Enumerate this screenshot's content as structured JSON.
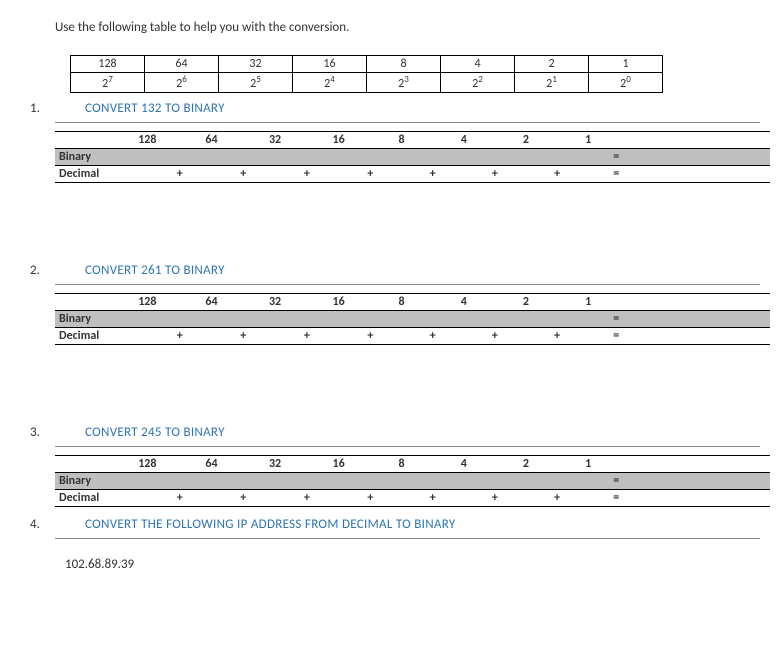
{
  "instruction": "Use the following table to help you with the conversion.",
  "reference": {
    "row1": [
      "128",
      "64",
      "32",
      "16",
      "8",
      "4",
      "2",
      "1"
    ],
    "row2": [
      {
        "base": "2",
        "exp": "7"
      },
      {
        "base": "2",
        "exp": "6"
      },
      {
        "base": "2",
        "exp": "5"
      },
      {
        "base": "2",
        "exp": "4"
      },
      {
        "base": "2",
        "exp": "3"
      },
      {
        "base": "2",
        "exp": "2"
      },
      {
        "base": "2",
        "exp": "1"
      },
      {
        "base": "2",
        "exp": "0"
      }
    ]
  },
  "problems": [
    {
      "num": "1.",
      "title": "CONVERT 132 TO BINARY"
    },
    {
      "num": "2.",
      "title": "CONVERT 261 TO BINARY"
    },
    {
      "num": "3.",
      "title": "CONVERT 245 TO BINARY"
    },
    {
      "num": "4.",
      "title": "CONVERT THE FOLLOWING IP ADDRESS FROM DECIMAL TO BINARY"
    }
  ],
  "work": {
    "headers": [
      "128",
      "64",
      "32",
      "16",
      "8",
      "4",
      "2",
      "1"
    ],
    "binary_label": "Binary",
    "decimal_label": "Decimal",
    "plus": "+",
    "eq": "="
  },
  "ip": "102.68.89.39"
}
